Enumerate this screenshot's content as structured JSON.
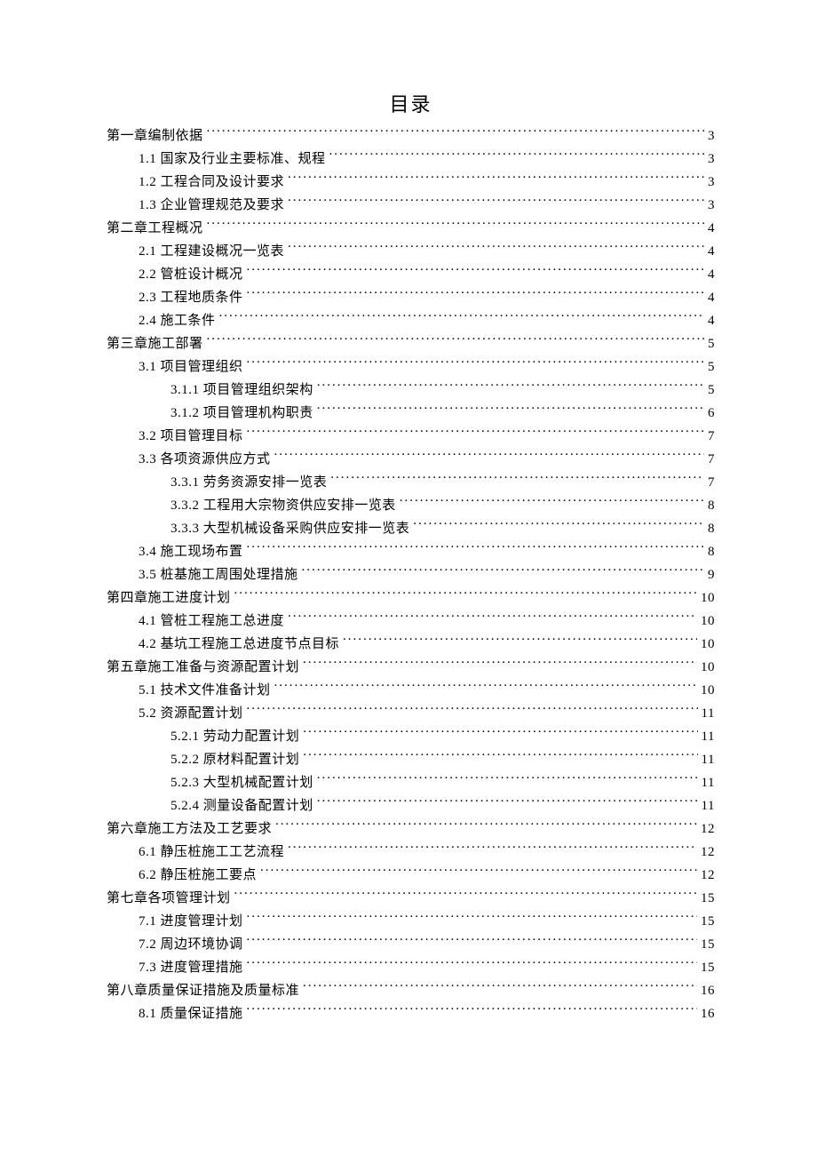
{
  "title": "目录",
  "toc": [
    {
      "level": 0,
      "label": "第一章编制依据",
      "page": "3"
    },
    {
      "level": 1,
      "label": "1.1 国家及行业主要标准、规程",
      "page": "3"
    },
    {
      "level": 1,
      "label": "1.2 工程合同及设计要求",
      "page": "3"
    },
    {
      "level": 1,
      "label": "1.3 企业管理规范及要求",
      "page": "3"
    },
    {
      "level": 0,
      "label": "第二章工程概况",
      "page": "4"
    },
    {
      "level": 1,
      "label": "2.1 工程建设概况一览表",
      "page": "4"
    },
    {
      "level": 1,
      "label": "2.2  管桩设计概况",
      "page": "4"
    },
    {
      "level": 1,
      "label": "2.3  工程地质条件",
      "page": "4"
    },
    {
      "level": 1,
      "label": "2.4  施工条件",
      "page": "4"
    },
    {
      "level": 0,
      "label": "第三章施工部署",
      "page": "5"
    },
    {
      "level": 1,
      "label": "3.1  项目管理组织",
      "page": "5"
    },
    {
      "level": 2,
      "label": "3.1.1 项目管理组织架构",
      "page": "5"
    },
    {
      "level": 2,
      "label": "3.1.2 项目管理机构职责",
      "page": "6"
    },
    {
      "level": 1,
      "label": "3.2  项目管理目标",
      "page": "7"
    },
    {
      "level": 1,
      "label": "3.3  各项资源供应方式",
      "page": "7"
    },
    {
      "level": 2,
      "label": "3.3.1 劳务资源安排一览表",
      "page": "7"
    },
    {
      "level": 2,
      "label": "3.3.2 工程用大宗物资供应安排一览表",
      "page": "8"
    },
    {
      "level": 2,
      "label": "3.3.3 大型机械设备采购供应安排一览表",
      "page": "8"
    },
    {
      "level": 1,
      "label": "3.4  施工现场布置",
      "page": "8"
    },
    {
      "level": 1,
      "label": "3.5  桩基施工周围处理措施",
      "page": "9"
    },
    {
      "level": 0,
      "label": "第四章施工进度计划",
      "page": "10"
    },
    {
      "level": 1,
      "label": "4.1 管桩工程施工总进度",
      "page": "10"
    },
    {
      "level": 1,
      "label": "4.2  基坑工程施工总进度节点目标",
      "page": "10"
    },
    {
      "level": 0,
      "label": "第五章施工准备与资源配置计划",
      "page": "10"
    },
    {
      "level": 1,
      "label": "5.1 技术文件准备计划",
      "page": "10"
    },
    {
      "level": 1,
      "label": "5.2  资源配置计划",
      "page": "11"
    },
    {
      "level": 2,
      "label": "5.2.1 劳动力配置计划",
      "page": "11"
    },
    {
      "level": 2,
      "label": "5.2.2 原材料配置计划",
      "page": "11"
    },
    {
      "level": 2,
      "label": "5.2.3 大型机械配置计划",
      "page": "11"
    },
    {
      "level": 2,
      "label": "5.2.4 测量设备配置计划",
      "page": "11"
    },
    {
      "level": 0,
      "label": "第六章施工方法及工艺要求",
      "page": "12"
    },
    {
      "level": 1,
      "label": "6.1 静压桩施工工艺流程",
      "page": "12"
    },
    {
      "level": 1,
      "label": "6.2 静压桩施工要点",
      "page": "12"
    },
    {
      "level": 0,
      "label": "第七章各项管理计划",
      "page": "15"
    },
    {
      "level": 1,
      "label": "7.1 进度管理计划",
      "page": "15"
    },
    {
      "level": 1,
      "label": "7.2 周边环境协调",
      "page": "15"
    },
    {
      "level": 1,
      "label": "7.3 进度管理措施",
      "page": "15"
    },
    {
      "level": 0,
      "label": "第八章质量保证措施及质量标准",
      "page": "16"
    },
    {
      "level": 1,
      "label": "8.1 质量保证措施",
      "page": "16"
    }
  ]
}
